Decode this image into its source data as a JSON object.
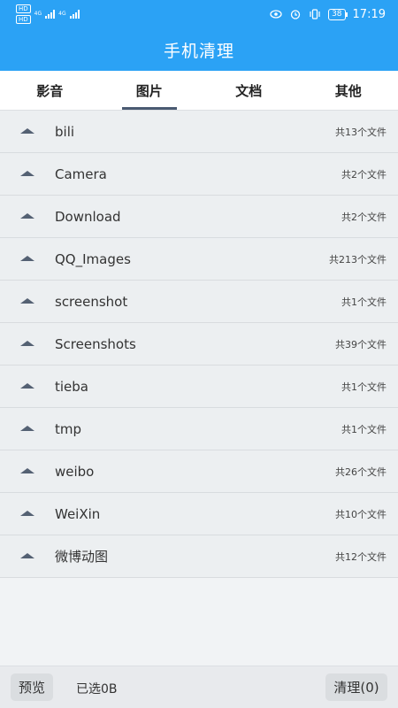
{
  "status_bar": {
    "hd_label": "HD",
    "net_label": "4G",
    "battery": "38",
    "time": "17:19"
  },
  "app": {
    "title": "手机清理"
  },
  "tabs": [
    {
      "label": "影音",
      "active": false
    },
    {
      "label": "图片",
      "active": true
    },
    {
      "label": "文档",
      "active": false
    },
    {
      "label": "其他",
      "active": false
    }
  ],
  "folders": [
    {
      "name": "bili",
      "count": "共13个文件"
    },
    {
      "name": "Camera",
      "count": "共2个文件"
    },
    {
      "name": "Download",
      "count": "共2个文件"
    },
    {
      "name": "QQ_Images",
      "count": "共213个文件"
    },
    {
      "name": "screenshot",
      "count": "共1个文件"
    },
    {
      "name": "Screenshots",
      "count": "共39个文件"
    },
    {
      "name": "tieba",
      "count": "共1个文件"
    },
    {
      "name": "tmp",
      "count": "共1个文件"
    },
    {
      "name": "weibo",
      "count": "共26个文件"
    },
    {
      "name": "WeiXin",
      "count": "共10个文件"
    },
    {
      "name": "微博动图",
      "count": "共12个文件"
    }
  ],
  "bottom": {
    "preview_label": "预览",
    "selected_label": "已选0B",
    "clean_label": "清理(0)"
  },
  "colors": {
    "accent": "#2ba2f5",
    "tab_indicator": "#4a5a72"
  },
  "icons": [
    "eye-icon",
    "alarm-icon",
    "vibrate-icon",
    "battery-icon",
    "signal-icon",
    "expand-triangle-icon"
  ]
}
